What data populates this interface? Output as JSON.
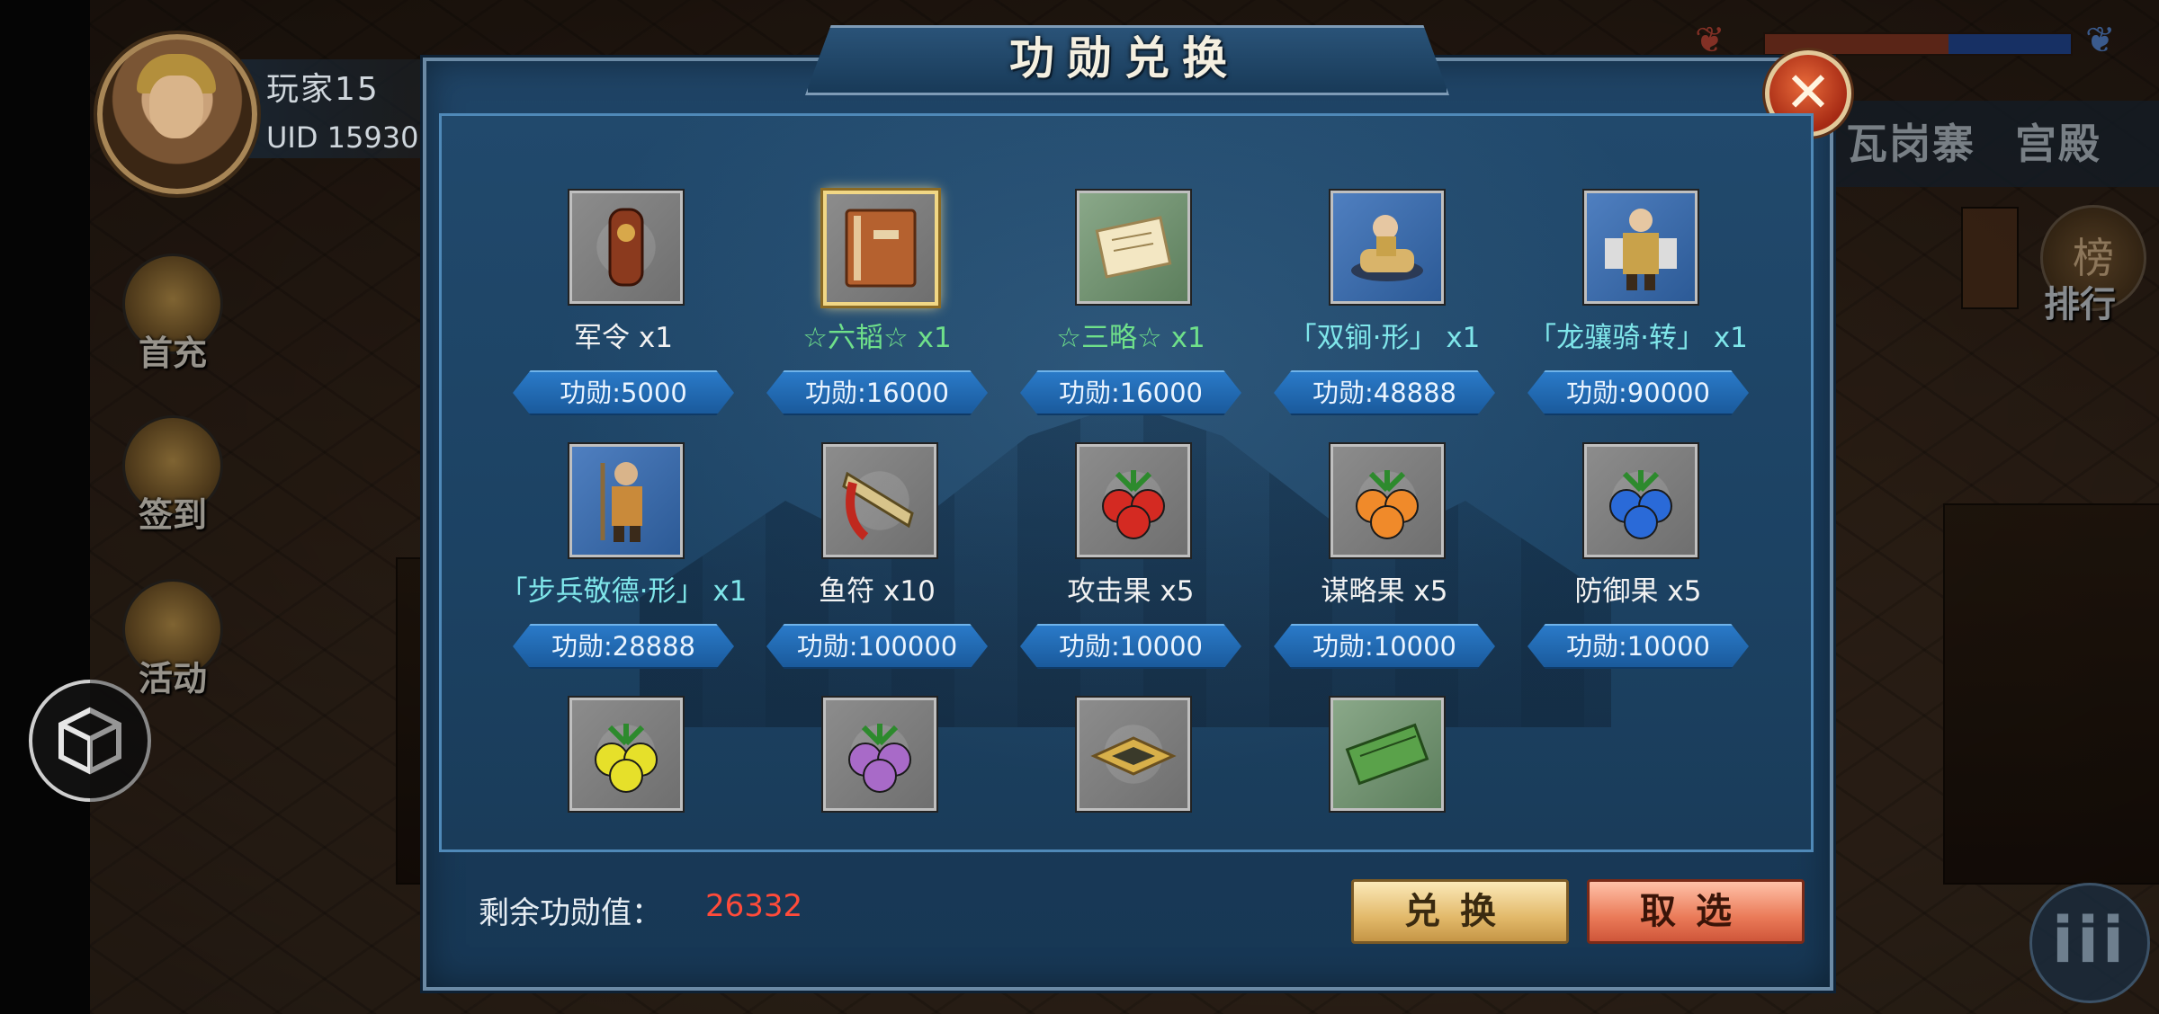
{
  "hud": {
    "player_name": "玩家15",
    "player_uid": "UID 15930",
    "side_buttons": [
      "首充",
      "签到",
      "活动"
    ],
    "right_tabs": [
      "瓦岗寨",
      "宫殿"
    ],
    "rank_glyph": "榜",
    "rank_label": "排行",
    "menu_glyph": "iii"
  },
  "dialog": {
    "title": "功勋兑换",
    "close_glyph": "✕",
    "remaining_label": "剩余功勋值：",
    "remaining_value": "26332",
    "exchange_button": "兑换",
    "cancel_button": "取选",
    "items": [
      {
        "name": "军令 x1",
        "price": "功勋:5000",
        "icon": "command-token-icon"
      },
      {
        "name": "☆六韬☆ x1",
        "price": "功勋:16000",
        "icon": "book-icon",
        "selected": true
      },
      {
        "name": "☆三略☆ x1",
        "price": "功勋:16000",
        "icon": "scroll-icon"
      },
      {
        "name": "「双锏·形」 x1",
        "price": "功勋:48888",
        "icon": "cavalry-general-icon"
      },
      {
        "name": "「龙骧骑·转」 x1",
        "price": "功勋:90000",
        "icon": "armored-general-icon"
      },
      {
        "name": "「步兵敬德·形」 x1",
        "price": "功勋:28888",
        "icon": "infantry-general-icon"
      },
      {
        "name": "鱼符 x10",
        "price": "功勋:100000",
        "icon": "fish-tally-icon"
      },
      {
        "name": "攻击果 x5",
        "price": "功勋:10000",
        "icon": "red-fruit-icon"
      },
      {
        "name": "谋略果 x5",
        "price": "功勋:10000",
        "icon": "orange-fruit-icon"
      },
      {
        "name": "防御果 x5",
        "price": "功勋:10000",
        "icon": "blue-fruit-icon"
      },
      {
        "name": "",
        "price": "",
        "icon": "yellow-fruit-icon"
      },
      {
        "name": "",
        "price": "",
        "icon": "purple-fruit-icon"
      },
      {
        "name": "",
        "price": "",
        "icon": "golden-map-icon"
      },
      {
        "name": "",
        "price": "",
        "icon": "bamboo-scroll-icon"
      }
    ]
  },
  "colors": {
    "dialog_bg": "#1f4466",
    "price_tag": "#2a7ac8",
    "remaining_value": "#ff4b3a",
    "highlight_green": "#6fe08a",
    "highlight_cyan": "#7fe6ea"
  }
}
